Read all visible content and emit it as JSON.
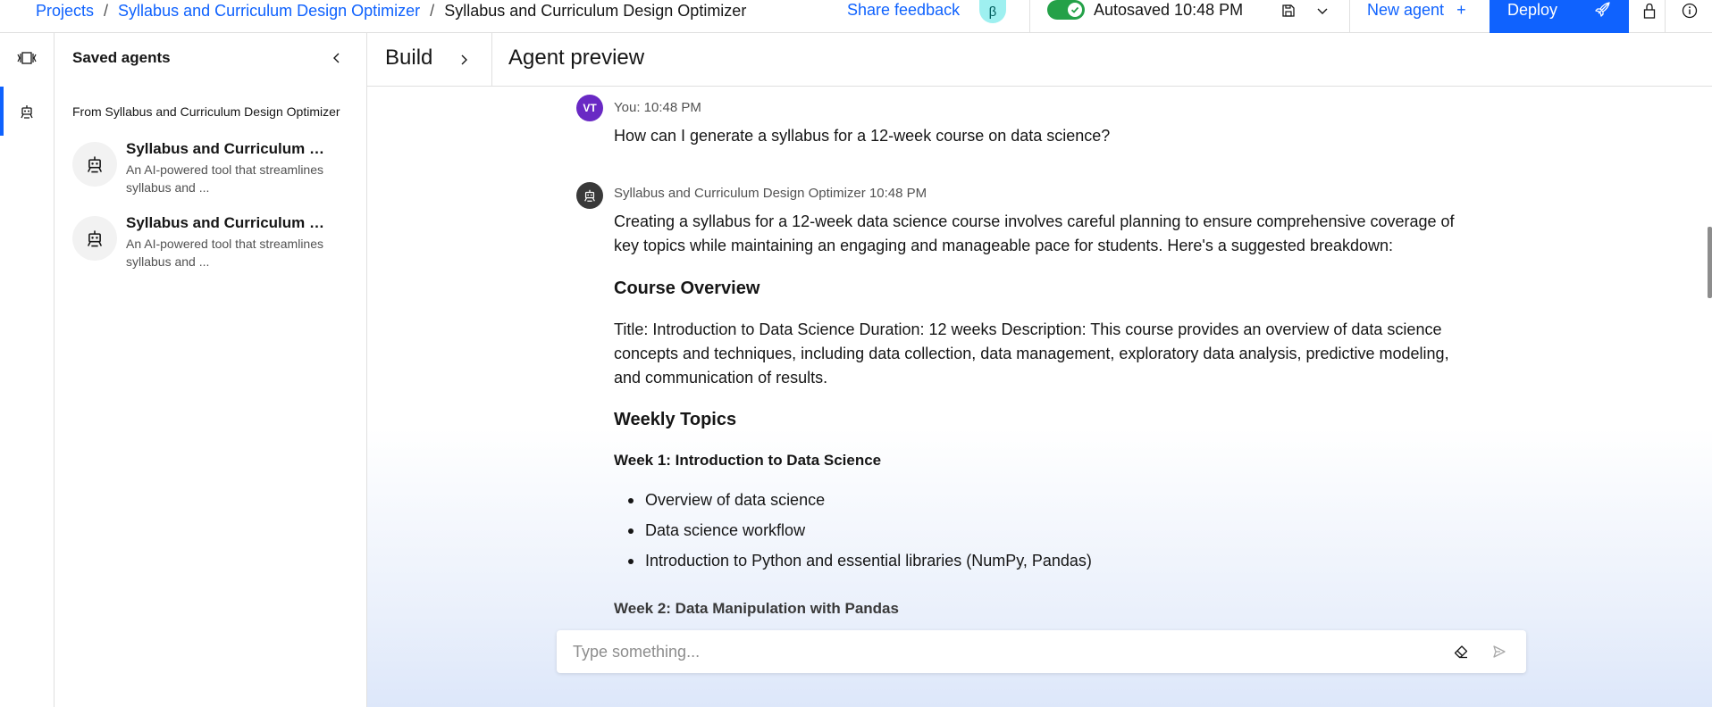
{
  "breadcrumb": {
    "items": [
      "Projects",
      "Syllabus and Curriculum Design Optimizer"
    ],
    "current": "Syllabus and Curriculum Design Optimizer",
    "separator": "/"
  },
  "header": {
    "share_feedback": "Share feedback",
    "beta_badge": "β",
    "autosave_status": "Autosaved 10:48 PM",
    "new_agent": "New agent",
    "new_agent_plus": "+",
    "deploy": "Deploy"
  },
  "panel": {
    "title": "Saved agents",
    "section": "From Syllabus and Curriculum Design Optimizer",
    "agents": [
      {
        "name": "Syllabus and Curriculum Design Optimizer",
        "desc": "An AI-powered tool that streamlines syllabus and ..."
      },
      {
        "name": "Syllabus and Curriculum Design Optimizer",
        "desc": "An AI-powered tool that streamlines syllabus and ..."
      }
    ]
  },
  "tabs": {
    "build": "Build",
    "preview": "Agent preview"
  },
  "chat": {
    "user": {
      "initials": "VT",
      "meta": "You: 10:48 PM",
      "text": "How can I generate a syllabus for a 12-week course on data science?"
    },
    "agent": {
      "meta": "Syllabus and Curriculum Design Optimizer 10:48 PM",
      "intro": "Creating a syllabus for a 12-week data science course involves careful planning to ensure comprehensive coverage of key topics while maintaining an engaging and manageable pace for students. Here's a suggested breakdown:",
      "overview_heading": "Course Overview",
      "overview_text": "Title: Introduction to Data Science Duration: 12 weeks Description: This course provides an overview of data science concepts and techniques, including data collection, data management, exploratory data analysis, predictive modeling, and communication of results.",
      "weekly_heading": "Weekly Topics",
      "week1_heading": "Week 1: Introduction to Data Science",
      "week1_items": [
        "Overview of data science",
        "Data science workflow",
        "Introduction to Python and essential libraries (NumPy, Pandas)"
      ],
      "week2_heading": "Week 2: Data Manipulation with Pandas"
    },
    "input_placeholder": "Type something..."
  },
  "colors": {
    "accent": "#0f62fe",
    "toggle_on": "#24a148",
    "user_avatar": "#6929c4",
    "agent_avatar": "#393939"
  },
  "icons": [
    "layout-toggle-icon",
    "robot-icon",
    "chevron-left-icon",
    "chevron-right-icon",
    "save-icon",
    "chevron-down-icon",
    "rocket-icon",
    "lock-icon",
    "info-icon",
    "eraser-icon",
    "send-icon",
    "checkmark-icon"
  ]
}
